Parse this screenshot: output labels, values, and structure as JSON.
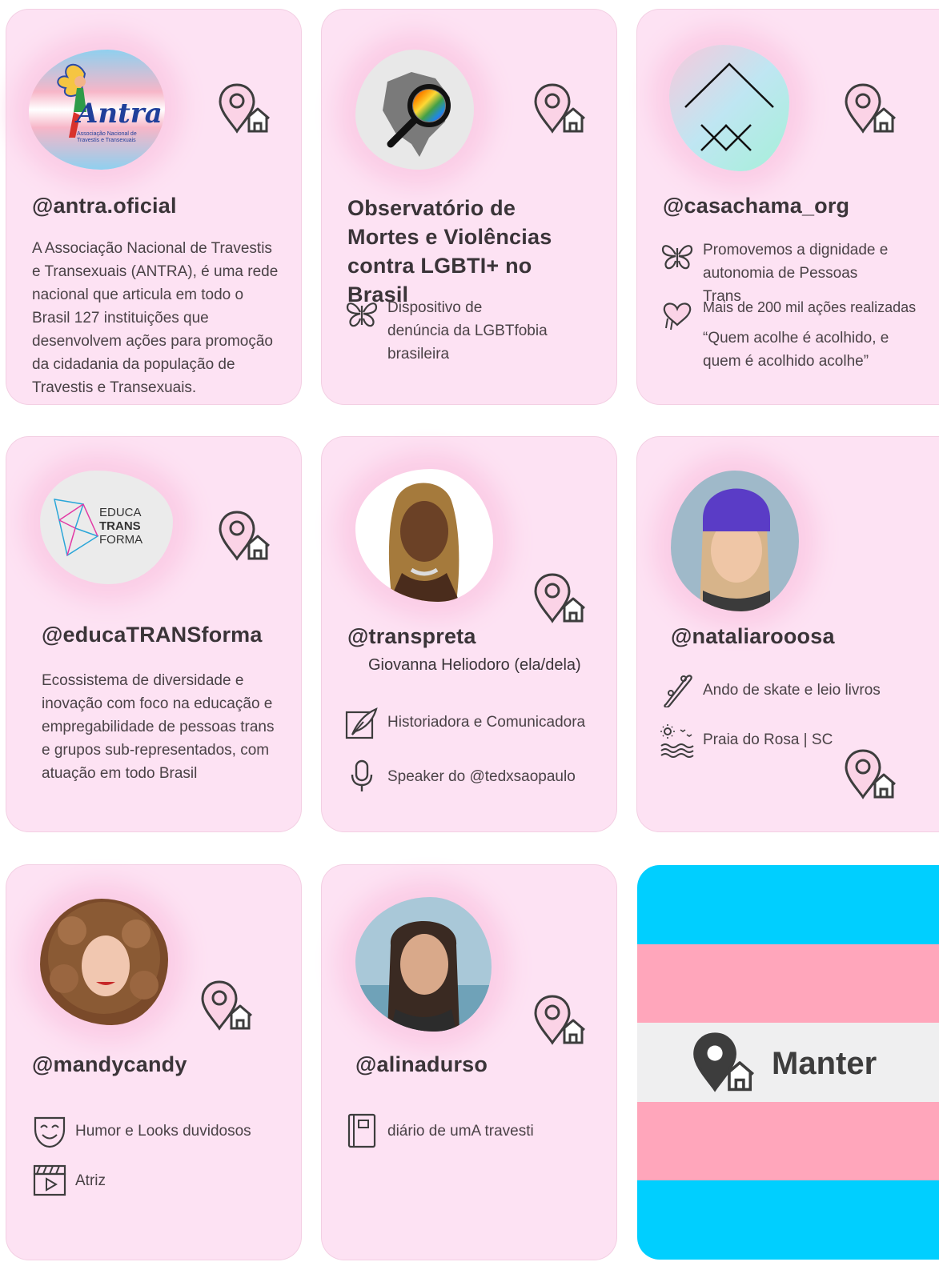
{
  "cards": [
    {
      "handle": "@antra.oficial",
      "logo_text": "Antra",
      "logo_sub": "Associação Nacional de Travestis e Transexuais",
      "description": "A Associação Nacional de Travestis e Transexuais (ANTRA), é uma rede nacional que articula em todo o Brasil 127 instituições que desenvolvem ações para promoção da cidadania da população de Travestis e Transexuais."
    },
    {
      "title": "Observatório de Mortes e Violências contra LGBTI+ no Brasil",
      "items": [
        {
          "icon": "butterfly-icon",
          "text": "Dispositivo de denúncia da LGBTfobia brasileira"
        }
      ]
    },
    {
      "handle": "@casachama_org",
      "items": [
        {
          "icon": "butterfly-icon",
          "text": "Promovemos a dignidade e autonomia de Pessoas Trans"
        },
        {
          "icon": "heart-hands-icon",
          "text": "Mais de 200 mil ações realizadas"
        },
        {
          "icon": "",
          "text": "“Quem acolhe é acolhido, e quem é acolhido acolhe”"
        }
      ]
    },
    {
      "handle": "@educaTRANSforma",
      "logo_lines": [
        "EDUCA",
        "TRANS",
        "FORMA"
      ],
      "description": "Ecossistema de diversidade e inovação com foco na educação e empregabilidade de pessoas trans e grupos sub-representados, com atuação em todo Brasil"
    },
    {
      "handle": "@transpreta",
      "name": "Giovanna Heliodoro (ela/dela)",
      "items": [
        {
          "icon": "quill-icon",
          "text": "Historiadora e Comunicadora"
        },
        {
          "icon": "microphone-icon",
          "text": "Speaker do @tedxsaopaulo"
        }
      ]
    },
    {
      "handle": "@nataliarooosa",
      "items": [
        {
          "icon": "skateboard-icon",
          "text": "Ando de skate e leio livros"
        },
        {
          "icon": "beach-icon",
          "text": "Praia do Rosa | SC"
        }
      ]
    },
    {
      "handle": "@mandycandy",
      "items": [
        {
          "icon": "theater-mask-icon",
          "text": "Humor e Looks duvidosos"
        },
        {
          "icon": "clapperboard-icon",
          "text": "Atriz"
        }
      ]
    },
    {
      "handle": "@alinadurso",
      "items": [
        {
          "icon": "notebook-icon",
          "text": "diário de umA travesti"
        }
      ]
    }
  ],
  "manter": {
    "label": "Manter",
    "stripe_colors": [
      "#00cfff",
      "#ffa6bb",
      "#efeff0",
      "#ffa6bb",
      "#00cfff"
    ]
  },
  "colors": {
    "card_bg": "#fde2f3",
    "pin_stroke": "#3d3d3d",
    "pin_fill": "#f9b7d6"
  }
}
